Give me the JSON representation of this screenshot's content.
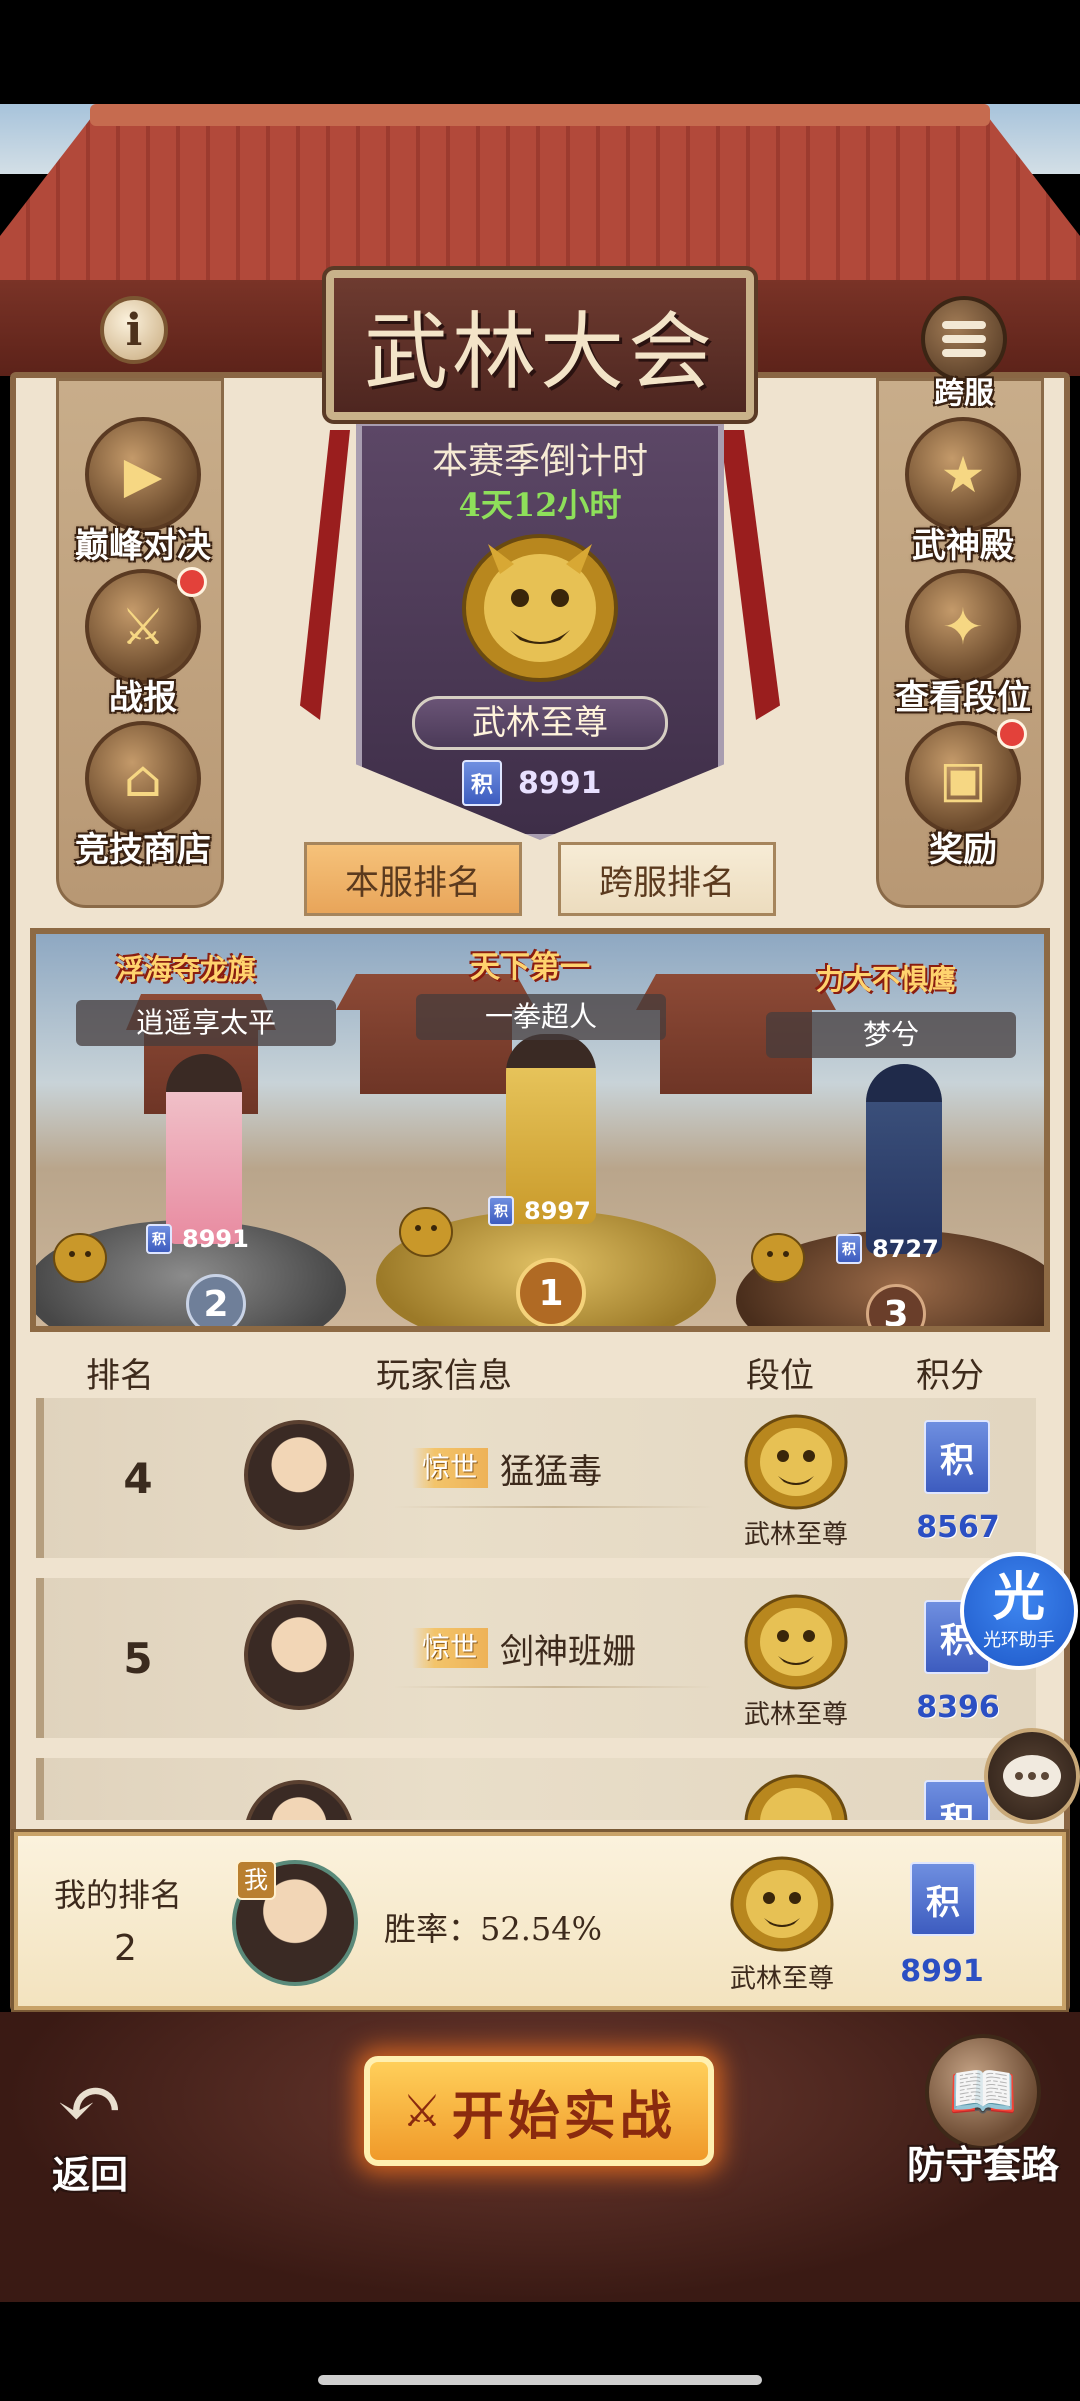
{
  "header": {
    "title": "武林大会",
    "info_glyph": "i",
    "cross_server_label": "跨服"
  },
  "season": {
    "countdown_title": "本赛季倒计时",
    "countdown_value": "4天12小时",
    "rank_name": "武林至尊",
    "score": "8991"
  },
  "left_menu": [
    {
      "label": "巅峰对决",
      "icon": "play-icon",
      "badge": false
    },
    {
      "label": "战报",
      "icon": "battle-report-icon",
      "badge": true
    },
    {
      "label": "竞技商店",
      "icon": "shop-icon",
      "badge": false
    }
  ],
  "right_menu": [
    {
      "label": "武神殿",
      "icon": "hall-icon",
      "badge": false
    },
    {
      "label": "查看段位",
      "icon": "tier-icon",
      "badge": false
    },
    {
      "label": "奖励",
      "icon": "reward-chest-icon",
      "badge": true
    }
  ],
  "tabs": [
    {
      "label": "本服排名",
      "active": true
    },
    {
      "label": "跨服排名",
      "active": false
    }
  ],
  "podium": {
    "first": {
      "title": "天下第一",
      "name": "一拳超人",
      "score": "8997",
      "place": "1"
    },
    "second": {
      "title": "浮海夺龙旗",
      "name": "逍遥享太平",
      "score": "8991",
      "place": "2"
    },
    "third": {
      "title": "力大不惧鹰",
      "name": "梦兮",
      "score": "8727",
      "place": "3"
    }
  },
  "table": {
    "headers": [
      "排名",
      "玩家信息",
      "段位",
      "积分"
    ],
    "rows": [
      {
        "rank": "4",
        "title": "惊世",
        "name": "猛猛毒",
        "tier": "武林至尊",
        "score": "8567"
      },
      {
        "rank": "5",
        "title": "惊世",
        "name": "剑神班姗",
        "tier": "武林至尊",
        "score": "8396"
      },
      {
        "rank": "",
        "title": "",
        "name": "",
        "tier": "",
        "score": ""
      }
    ]
  },
  "my_rank": {
    "label": "我的排名",
    "rank": "2",
    "me_tag": "我",
    "win_rate": "胜率：52.54%",
    "tier": "武林至尊",
    "score": "8991"
  },
  "points_glyph": "积",
  "bottom": {
    "back_label": "返回",
    "start_label": "开始实战",
    "defense_label": "防守套路"
  },
  "floating": {
    "helper_glyph": "光",
    "helper_label": "光环助手"
  },
  "colors": {
    "accent_gold": "#f0b65a",
    "score_blue": "#2b4fc3",
    "countdown_green": "#8ee05a",
    "badge_red": "#e3413a"
  }
}
